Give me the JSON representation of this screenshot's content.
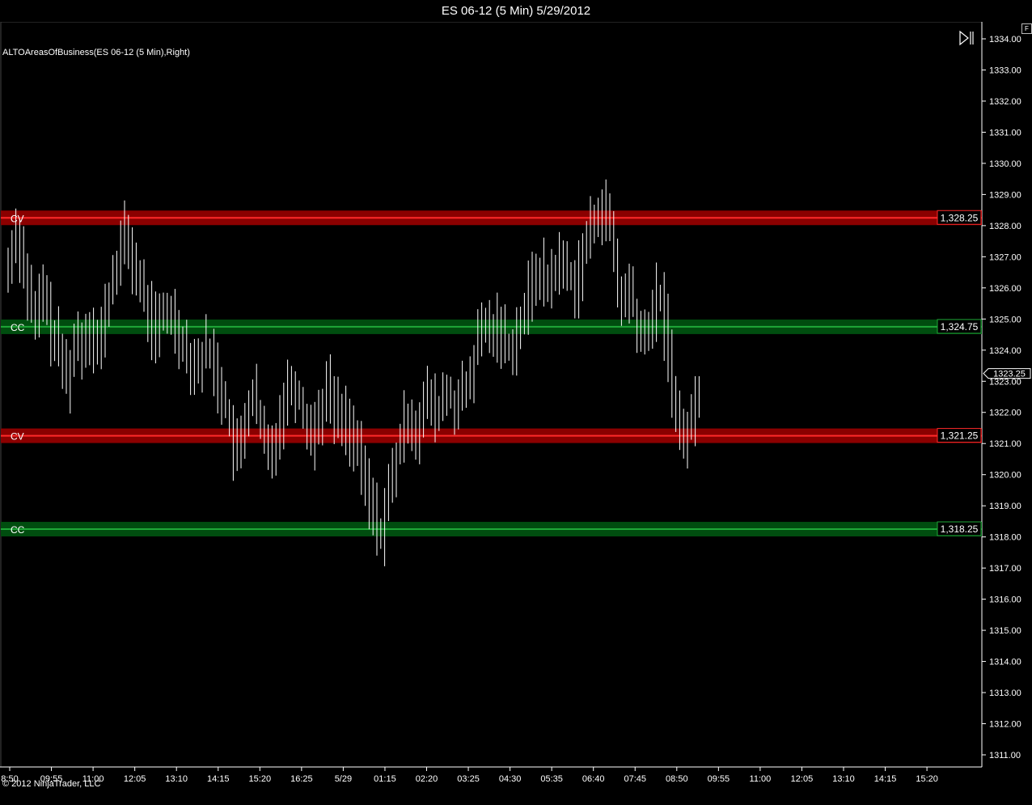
{
  "window": {
    "title": "ES 06-12 (5 Min)  5/29/2012"
  },
  "indicator": {
    "label": "ALTOAreasOfBusiness(ES 06-12 (5 Min),Right)"
  },
  "footer": {
    "copyright": "© 2012 NinjaTrader, LLC"
  },
  "controls": {
    "f_button": "F",
    "scroll_end_icon": "scroll-to-end-icon"
  },
  "colors": {
    "background": "#000000",
    "bar": "#ffffff",
    "cv_zone": "#8b0000",
    "cv_line": "#ff2a2a",
    "cc_zone": "#004d0f",
    "cc_line": "#1fa838",
    "axis": "#ffffff"
  },
  "chart_data": {
    "type": "ohlc-bar",
    "instrument": "ES 06-12",
    "interval": "5 Min",
    "ylim": [
      1310.5,
      1334.5
    ],
    "y_ticks": [
      "1311.00",
      "1312.00",
      "1313.00",
      "1314.00",
      "1315.00",
      "1316.00",
      "1317.00",
      "1318.00",
      "1319.00",
      "1320.00",
      "1321.00",
      "1322.00",
      "1323.00",
      "1324.00",
      "1325.00",
      "1326.00",
      "1327.00",
      "1328.00",
      "1329.00",
      "1330.00",
      "1331.00",
      "1332.00",
      "1333.00",
      "1334.00"
    ],
    "x_ticks": [
      "8:50",
      "09:55",
      "11:00",
      "12:05",
      "13:10",
      "14:15",
      "15:20",
      "16:25",
      "5/29",
      "01:15",
      "02:20",
      "03:25",
      "04:30",
      "05:35",
      "06:40",
      "07:45",
      "08:50",
      "09:55",
      "11:00",
      "12:05",
      "13:10",
      "14:15",
      "15:20"
    ],
    "last_price": "1323.25",
    "zones": [
      {
        "label": "CV",
        "price": 1328.25,
        "price_label": "1,328.25",
        "kind": "cv"
      },
      {
        "label": "CC",
        "price": 1324.75,
        "price_label": "1,324.75",
        "kind": "cc"
      },
      {
        "label": "CV",
        "price": 1321.25,
        "price_label": "1,321.25",
        "kind": "cv"
      },
      {
        "label": "CC",
        "price": 1318.25,
        "price_label": "1,318.25",
        "kind": "cc"
      }
    ],
    "price_path": [
      [
        1326.6,
        1327.5,
        1327.9,
        1327.2,
        1326.6,
        1325.9,
        1325.2,
        1324.8,
        1325.6,
        1326.0,
        1325.1,
        1324.6,
        1324.3,
        1323.9,
        1323.5,
        1323.1,
        1323.6,
        1324.2,
        1324.5,
        1324.0,
        1324.6,
        1324.9,
        1324.3,
        1324.0,
        1324.6,
        1325.2,
        1325.8,
        1326.4,
        1326.9,
        1327.3,
        1327.7,
        1327.3,
        1326.8,
        1326.4,
        1326.0,
        1325.6,
        1325.2,
        1324.8,
        1324.6,
        1324.9,
        1325.1,
        1325.3,
        1325.1,
        1324.8,
        1324.5,
        1324.2,
        1323.9,
        1323.7,
        1323.6,
        1323.6,
        1323.9,
        1324.1,
        1323.8,
        1323.4,
        1323.0,
        1322.6,
        1322.1,
        1321.5,
        1320.8,
        1320.5,
        1321.2,
        1321.8,
        1322.4,
        1322.6,
        1322.0,
        1321.4,
        1321.0,
        1320.5,
        1320.9,
        1321.4,
        1321.9,
        1322.4,
        1322.8,
        1323.0,
        1322.7,
        1322.4,
        1322.0,
        1321.6,
        1321.2,
        1321.6,
        1322.0,
        1322.4,
        1322.8,
        1322.5,
        1322.1,
        1321.8,
        1321.9,
        1321.7,
        1321.4,
        1321.1,
        1320.6,
        1320.1,
        1319.6,
        1319.2,
        1318.7,
        1318.3,
        1318.2,
        1318.9,
        1319.5,
        1320.0,
        1320.6,
        1321.1,
        1321.6,
        1322.0,
        1321.6,
        1321.4,
        1321.8,
        1322.2,
        1322.5,
        1322.2,
        1321.8,
        1322.2,
        1322.6,
        1322.6,
        1322.4,
        1322.2,
        1322.4,
        1322.6,
        1322.7,
        1323.2,
        1323.8,
        1324.3,
        1324.8,
        1324.7,
        1324.6,
        1324.7,
        1324.8,
        1324.5,
        1324.2,
        1324.1,
        1324.3,
        1324.6,
        1324.9,
        1325.3,
        1325.8,
        1326.2,
        1326.6,
        1326.5,
        1326.2,
        1326.1,
        1326.5,
        1326.7,
        1326.8,
        1326.7,
        1326.5,
        1326.3,
        1326.1,
        1326.6,
        1327.1,
        1327.5,
        1327.9,
        1328.2,
        1328.6,
        1328.5,
        1328.3,
        1327.8,
        1326.9,
        1325.9,
        1325.5,
        1325.7,
        1326.0,
        1325.4,
        1324.6,
        1324.2,
        1324.5,
        1324.9,
        1325.3,
        1325.7,
        1325.5,
        1324.8,
        1323.9,
        1322.9,
        1321.9,
        1321.1,
        1321.3,
        1321.5,
        1321.8,
        1322.3,
        1322.9
      ]
    ]
  }
}
